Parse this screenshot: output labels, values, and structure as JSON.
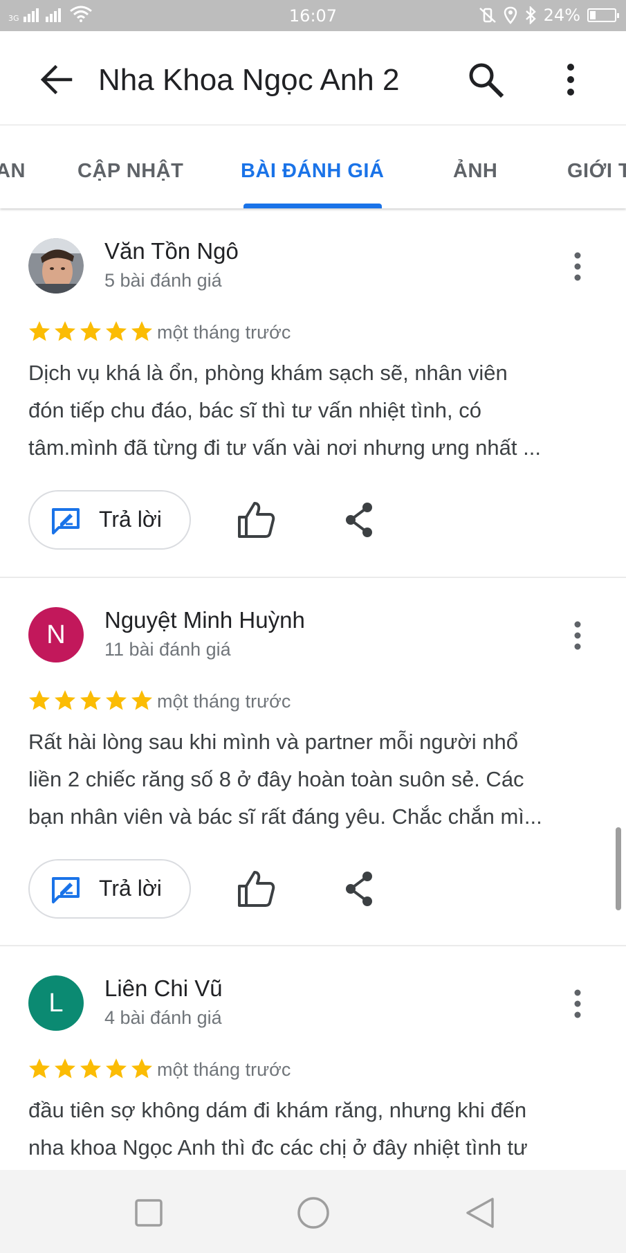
{
  "status_bar": {
    "network_type": "3G",
    "time": "16:07",
    "battery_percent": "24%",
    "battery_level": 0.24
  },
  "app_bar": {
    "title": "Nha Khoa Ngọc Anh 2"
  },
  "tabs": [
    {
      "label": "AN",
      "active": false
    },
    {
      "label": "CẬP NHẬT",
      "active": false
    },
    {
      "label": "BÀI ĐÁNH GIÁ",
      "active": true
    },
    {
      "label": "ẢNH",
      "active": false
    },
    {
      "label": "GIỚI T",
      "active": false
    }
  ],
  "reviews": [
    {
      "author": "Văn Tồn Ngô",
      "review_count": "5 bài đánh giá",
      "rating": 5,
      "time": "một tháng trước",
      "text_lines": [
        "Dịch vụ khá là ổn, phòng khám sạch sẽ, nhân viên",
        "đón tiếp chu đáo, bác sĩ thì tư vấn nhiệt tình, có",
        "tâm.mình đã từng đi tư vấn vài nơi nhưng ưng nhất ..."
      ],
      "avatar_type": "photo",
      "reply_label": "Trả lời"
    },
    {
      "author": "Nguyệt Minh Huỳnh",
      "review_count": "11 bài đánh giá",
      "rating": 5,
      "time": "một tháng trước",
      "text_lines": [
        "Rất hài lòng sau khi mình và partner mỗi người nhổ",
        "liền 2 chiếc răng số 8 ở đây hoàn toàn suôn sẻ. Các",
        "bạn nhân viên và bác sĩ rất đáng yêu. Chắc chắn mì..."
      ],
      "avatar_initial": "N",
      "avatar_color": "#c2185b",
      "reply_label": "Trả lời"
    },
    {
      "author": "Liên Chi Vũ",
      "review_count": "4 bài đánh giá",
      "rating": 5,
      "time": "một tháng trước",
      "text_lines": [
        "đầu tiên sợ không dám đi khám răng, nhưng khi đến",
        "nha khoa Ngọc Anh thì đc các chị ở đây nhiệt tình tư"
      ],
      "avatar_initial": "L",
      "avatar_color": "#0b8a72"
    }
  ],
  "colors": {
    "accent": "#1a73e8",
    "star": "#fbbc04"
  }
}
